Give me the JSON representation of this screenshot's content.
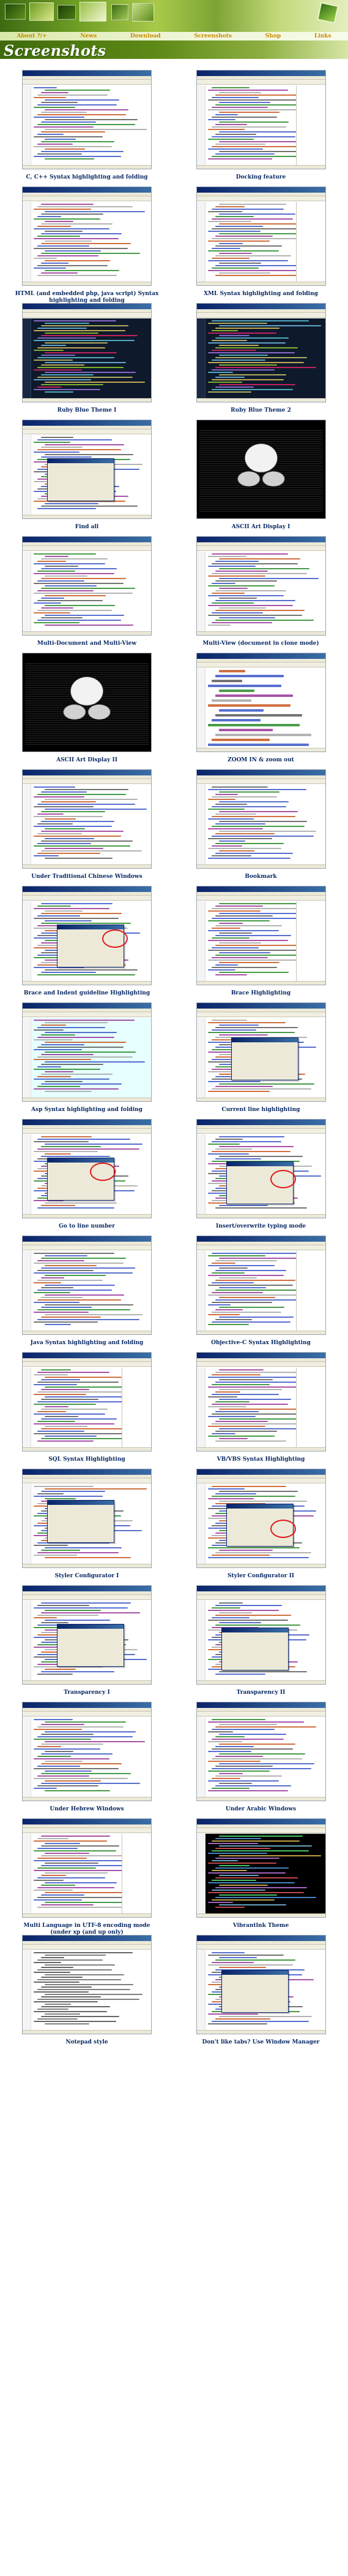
{
  "nav": {
    "items": [
      {
        "label": "About ?/+"
      },
      {
        "label": "News"
      },
      {
        "label": "Download"
      },
      {
        "label": "Screenshots"
      },
      {
        "label": "Shop"
      },
      {
        "label": "Links"
      }
    ]
  },
  "page": {
    "title": "Screenshots"
  },
  "gallery": {
    "items": [
      {
        "caption": "C, C++ Syntax highlighting and folding",
        "theme": "light"
      },
      {
        "caption": "Docking feature",
        "theme": "light-docked"
      },
      {
        "caption": "HTML (and embedded php, java script) Syntax highlighting and folding",
        "theme": "light"
      },
      {
        "caption": "XML Syntax highlighting and folding",
        "theme": "light-color"
      },
      {
        "caption": "Ruby Blue Theme I",
        "theme": "dark"
      },
      {
        "caption": "Ruby Blue Theme 2",
        "theme": "dark"
      },
      {
        "caption": "Find all",
        "theme": "light-dialog"
      },
      {
        "caption": "ASCII Art Display I",
        "theme": "ascii"
      },
      {
        "caption": "Multi-Document and Multi-View",
        "theme": "light"
      },
      {
        "caption": "Multi-View (document in clone mode)",
        "theme": "light"
      },
      {
        "caption": "ASCII Art Display II",
        "theme": "ascii"
      },
      {
        "caption": "ZOOM IN & zoom out",
        "theme": "light-zoom"
      },
      {
        "caption": "Under Traditional Chinese Windows",
        "theme": "light"
      },
      {
        "caption": "Bookmark",
        "theme": "light"
      },
      {
        "caption": "Brace and Indent guideline Highlighting",
        "theme": "light-dialog-red"
      },
      {
        "caption": "Brace Highlighting",
        "theme": "light-docked"
      },
      {
        "caption": "Asp Syntax highlighting and folding",
        "theme": "light-cyan"
      },
      {
        "caption": "Current line highlighting",
        "theme": "light-dialog"
      },
      {
        "caption": "Go to line number",
        "theme": "light-dialog-red"
      },
      {
        "caption": "Insert/overwrite typing mode",
        "theme": "light-dialog-red"
      },
      {
        "caption": "Java Syntax highlighting and folding",
        "theme": "light"
      },
      {
        "caption": "Objective-C Syntax Highlighting",
        "theme": "light-docked"
      },
      {
        "caption": "SQL Syntax Highlighting",
        "theme": "light-color"
      },
      {
        "caption": "VB/VBS Syntax Highlighting",
        "theme": "light-docked"
      },
      {
        "caption": "Styler Configurator I",
        "theme": "light-dialog"
      },
      {
        "caption": "Styler Configurator II",
        "theme": "light-dialog-red"
      },
      {
        "caption": "Transparency I",
        "theme": "light-dialog"
      },
      {
        "caption": "Transparency II",
        "theme": "light-dialog"
      },
      {
        "caption": "Under Hebrew Windows",
        "theme": "light"
      },
      {
        "caption": "Under Arabic Windows",
        "theme": "light"
      },
      {
        "caption": "Multi Language in UTF-8 encoding mode (under xp (and up only)",
        "theme": "light-color"
      },
      {
        "caption": "Vibrantlnk Theme",
        "theme": "black"
      },
      {
        "caption": "Notepad style",
        "theme": "plain"
      },
      {
        "caption": "Don't like tabs? Use Window Manager",
        "theme": "light-dialog"
      }
    ]
  },
  "colors": {
    "caption": "#0a2a63",
    "nav_link": "#c88a00",
    "title_text": "#ffffff",
    "banner_green": "#5e8a17"
  }
}
